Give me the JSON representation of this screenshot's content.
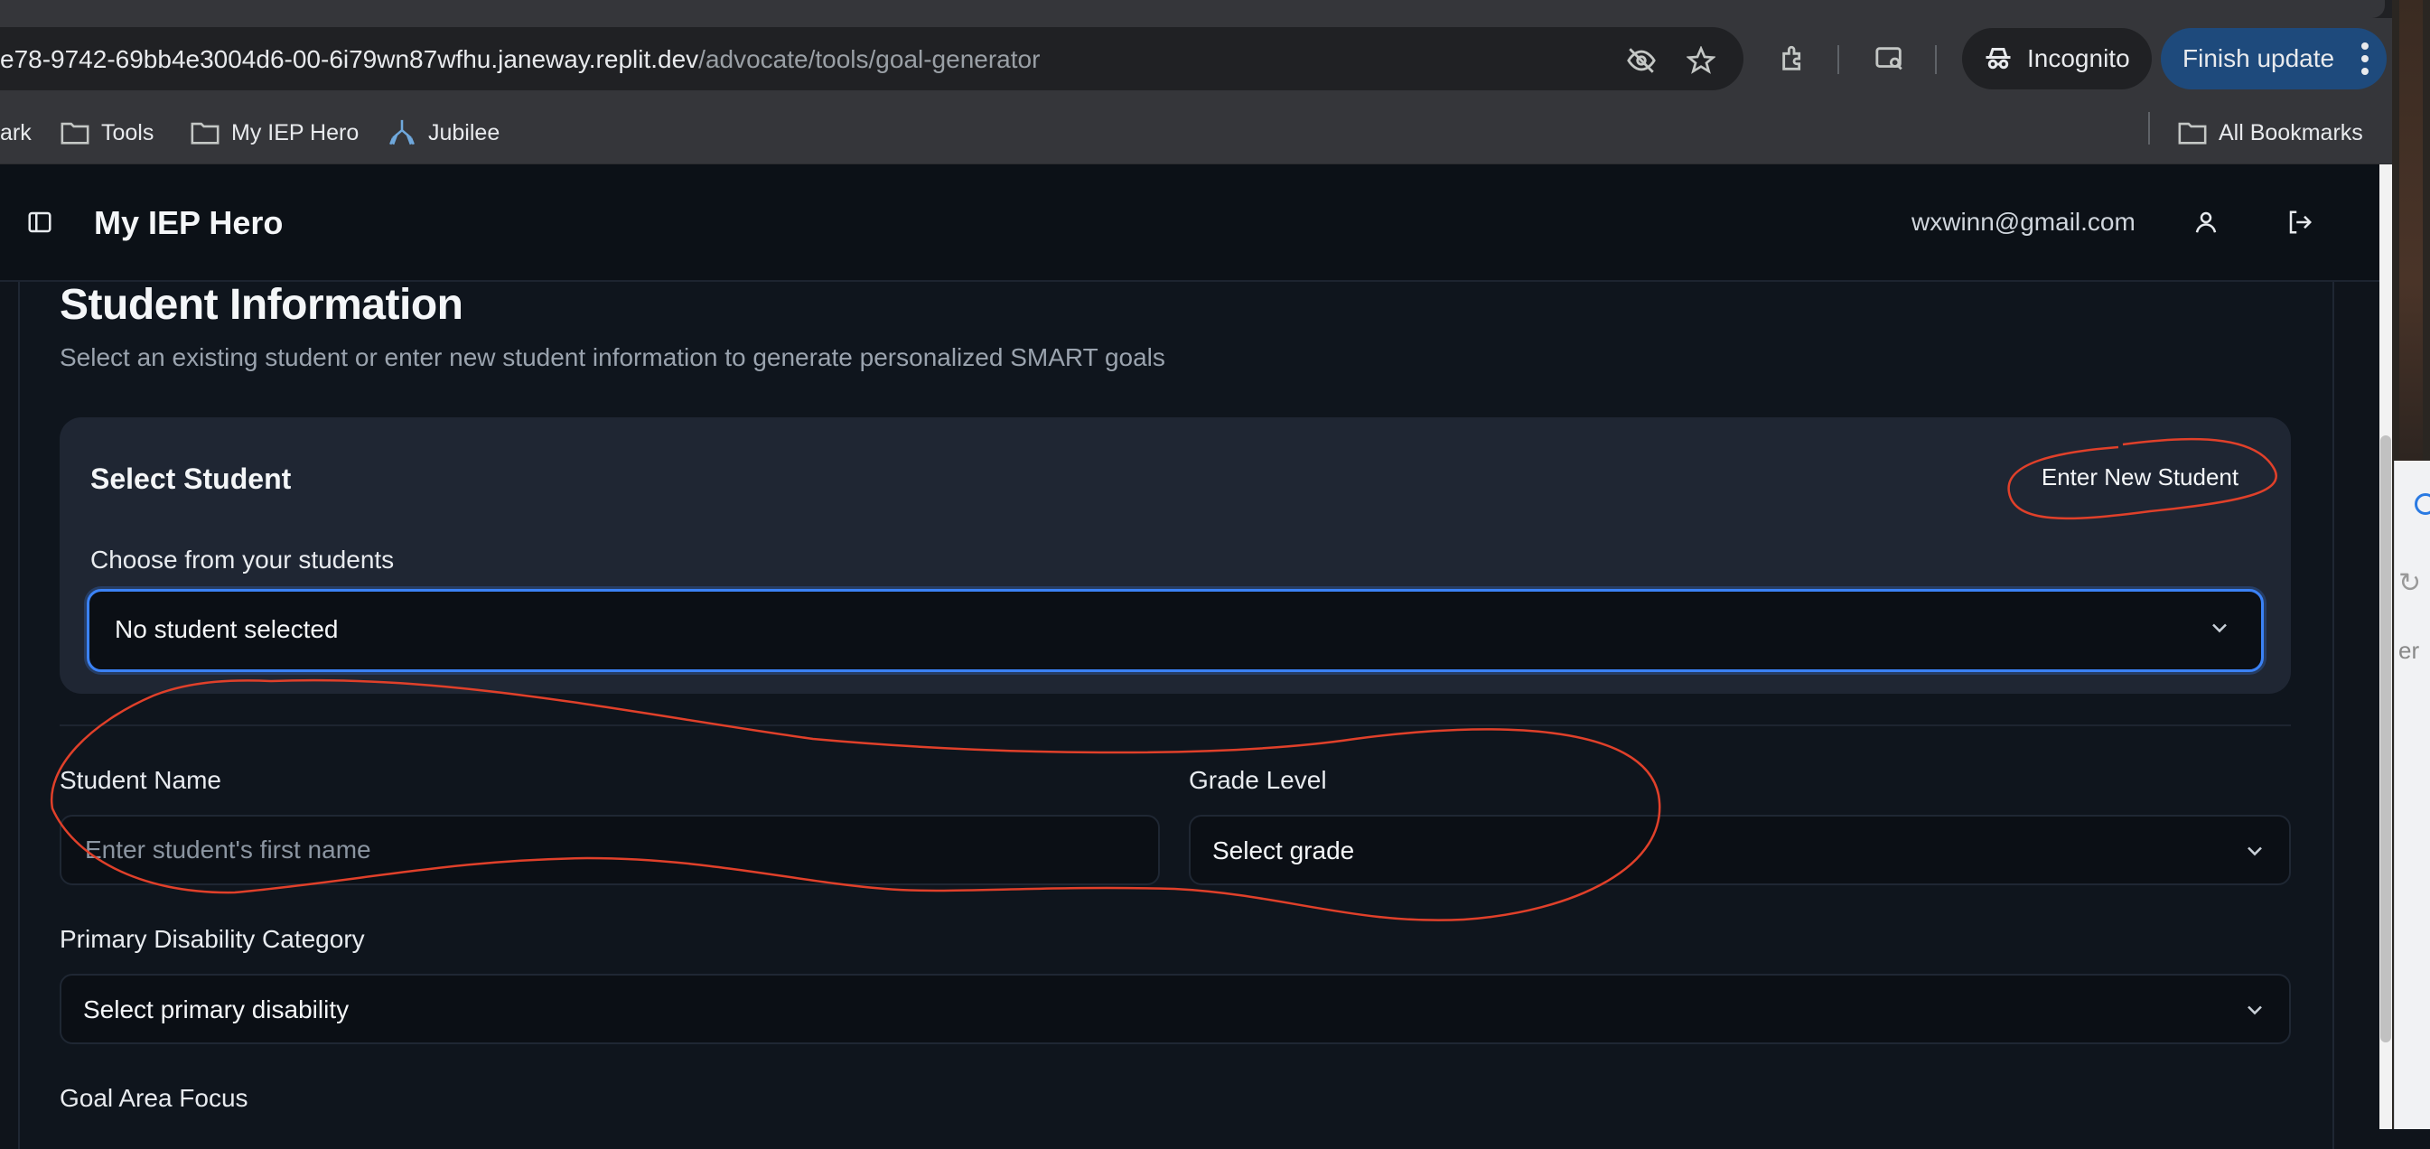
{
  "browser": {
    "url_host": "e78-9742-69bb4e3004d6-00-6i79wn87wfhu.janeway.replit.dev",
    "url_path": "/advocate/tools/goal-generator",
    "incognito_label": "Incognito",
    "finish_update_label": "Finish update",
    "bookmarks": [
      {
        "label": "ark",
        "icon": "bookmark-icon"
      },
      {
        "label": "Tools",
        "icon": "folder-icon"
      },
      {
        "label": "My IEP Hero",
        "icon": "folder-icon"
      },
      {
        "label": "Jubilee",
        "icon": "jubilee-icon"
      }
    ],
    "all_bookmarks_label": "All Bookmarks"
  },
  "header": {
    "app_title": "My IEP Hero",
    "user_email": "wxwinn@gmail.com"
  },
  "main": {
    "title": "Student Information",
    "description": "Select an existing student or enter new student information to generate personalized SMART goals",
    "select_student": {
      "title": "Select Student",
      "new_button": "Enter New Student",
      "choose_label": "Choose from your students",
      "selected_value": "No student selected"
    },
    "form": {
      "student_name_label": "Student Name",
      "student_name_placeholder": "Enter student's first name",
      "grade_label": "Grade Level",
      "grade_value": "Select grade",
      "disability_label": "Primary Disability Category",
      "disability_value": "Select primary disability",
      "goal_area_label": "Goal Area Focus"
    }
  },
  "colors": {
    "page_bg": "#0f141b",
    "card_bg": "#1f2633",
    "focus_ring": "#3b82f6",
    "annotation": "#e0402a",
    "chrome": "#35363a"
  }
}
